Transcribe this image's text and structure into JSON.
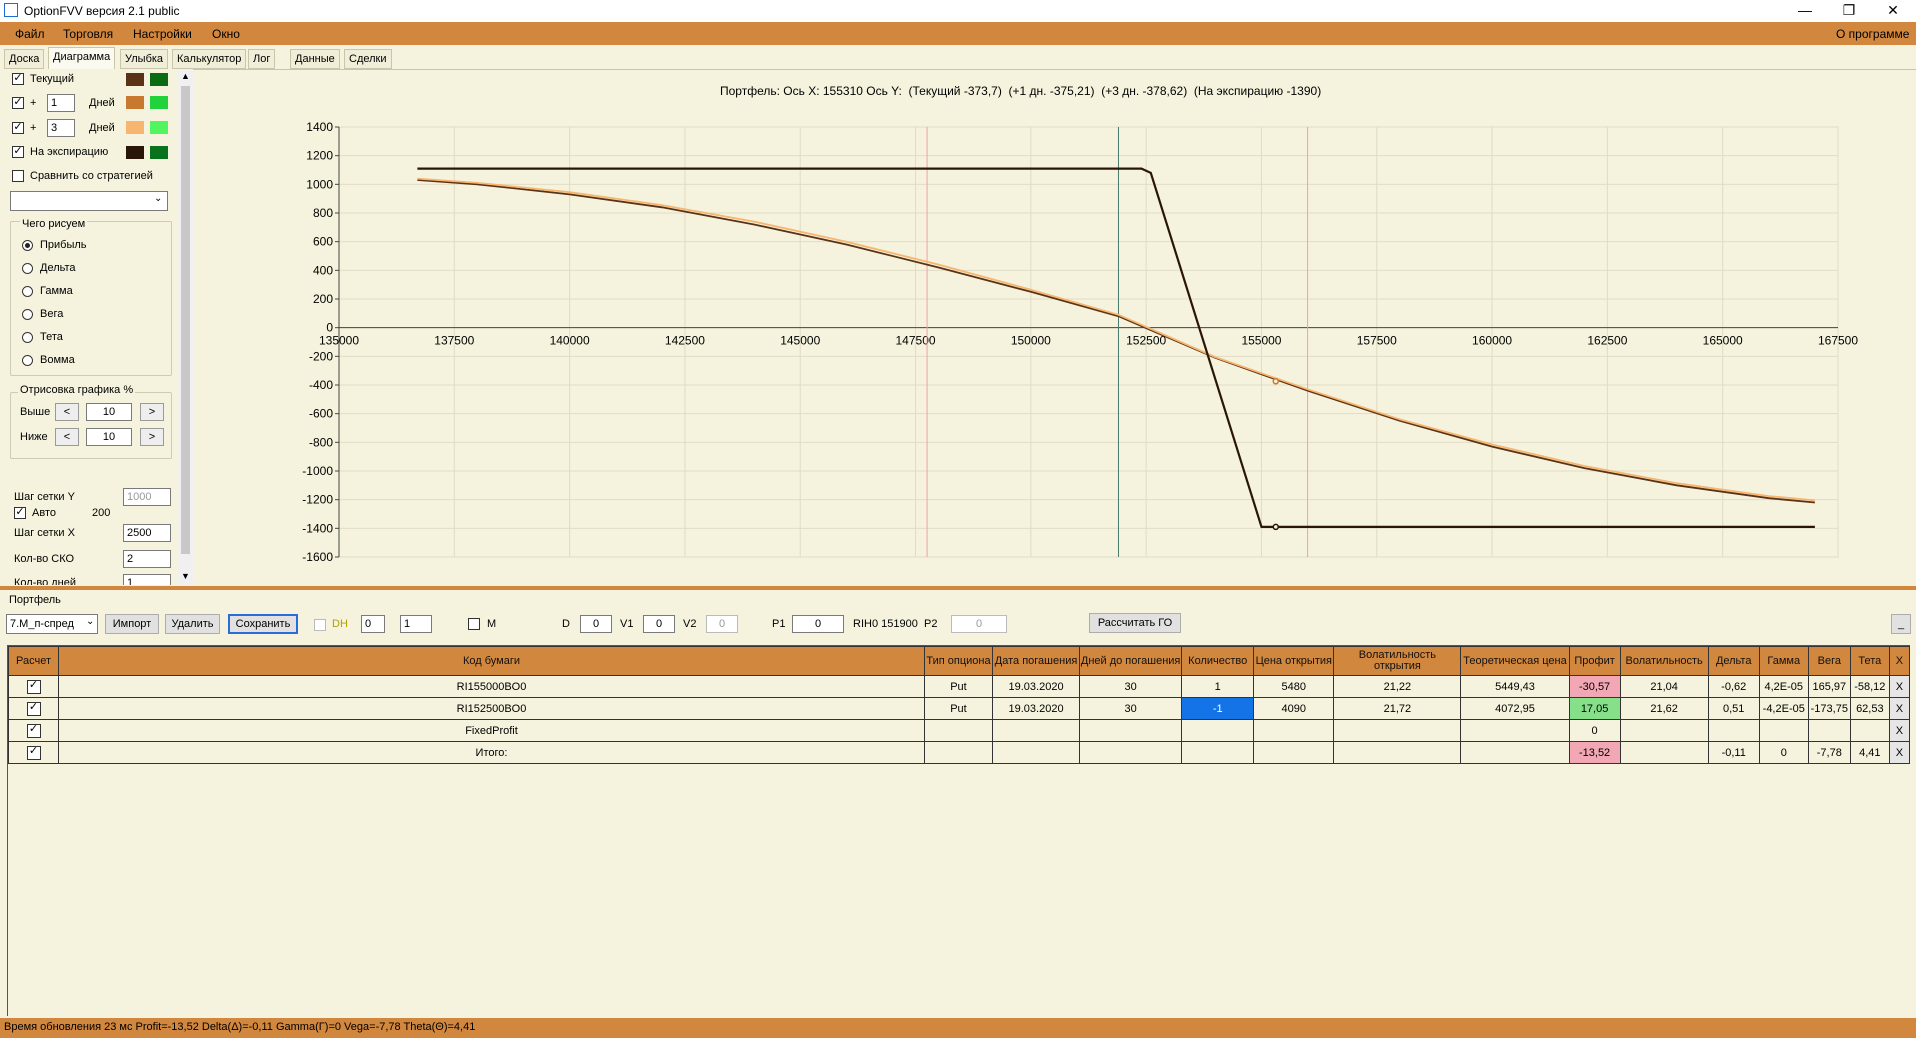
{
  "window": {
    "title": "OptionFVV версия 2.1 public",
    "minimize": "—",
    "restore": "❐",
    "close": "✕"
  },
  "menu": {
    "items": [
      "Файл",
      "Торговля",
      "Настройки",
      "Окно"
    ],
    "about": "О программе"
  },
  "tabs": [
    "Доска",
    "Диаграмма",
    "Улыбка",
    "Калькулятор",
    "Лог",
    "Данные",
    "Сделки"
  ],
  "active_tab": "Диаграмма",
  "left_panel": {
    "current_label": "Текущий",
    "plus": "+",
    "days1_value": "1",
    "days2_value": "3",
    "days_label": "Дней",
    "expiry_label": "На экспирацию",
    "compare_label": "Сравнить со стратегией",
    "draw_group_title": "Чего рисуем",
    "draw_options": [
      "Прибыль",
      "Дельта",
      "Гамма",
      "Вега",
      "Тета",
      "Вомма"
    ],
    "render_group_title": "Отрисовка графика %",
    "above_label": "Выше",
    "above_value": "10",
    "below_label": "Ниже",
    "below_value": "10",
    "dec": "<",
    "inc": ">",
    "grid_y_label": "Шаг сетки Y",
    "grid_y_value": "1000",
    "auto_label": "Авто",
    "auto_value": "200",
    "grid_x_label": "Шаг сетки X",
    "grid_x_value": "2500",
    "sko_label": "Кол-во СКО",
    "sko_value": "2",
    "days_count_label": "Кол-во дней",
    "days_count_value": "1",
    "colors": {
      "current": [
        "#5a3216",
        "#0a6b12"
      ],
      "plus1": [
        "#c8782f",
        "#21d23a"
      ],
      "plus3": [
        "#f7b56f",
        "#52f560"
      ],
      "expiry": [
        "#2a1608",
        "#08731a"
      ]
    }
  },
  "chart_header": "Портфель: Ось X: 155310 Ось Y:  (Текущий -373,7)  (+1 дн. -375,21)  (+3 дн. -378,62)  (На экспирацию -1390)",
  "chart_data": {
    "type": "line",
    "xlim": [
      135000,
      167500
    ],
    "ylim": [
      -1600,
      1400
    ],
    "x_ticks": [
      "135000",
      "137500",
      "140000",
      "142500",
      "145000",
      "147500",
      "150000",
      "152500",
      "155000",
      "157500",
      "160000",
      "162500",
      "165000",
      "167500"
    ],
    "y_ticks": [
      "1400",
      "1200",
      "1000",
      "800",
      "600",
      "400",
      "200",
      "0",
      "-200",
      "-400",
      "-600",
      "-800",
      "-1000",
      "-1200",
      "-1400",
      "-1600"
    ],
    "vertical_lines": [
      {
        "x": 147750,
        "color": "#f4a0a0"
      },
      {
        "x": 151900,
        "color": "#4a7a6a"
      },
      {
        "x": 156000,
        "color": "#f4a0a0"
      }
    ],
    "series": [
      {
        "color": "#5a3216",
        "x": [
          136700,
          138000,
          140000,
          142000,
          144000,
          146000,
          148000,
          150000,
          151900,
          154000,
          156000,
          158000,
          160000,
          162000,
          164000,
          166000,
          167000
        ],
        "y": [
          1030,
          1000,
          930,
          840,
          720,
          580,
          420,
          250,
          80,
          -210,
          -440,
          -650,
          -830,
          -980,
          -1100,
          -1190,
          -1220
        ]
      },
      {
        "color": "#f7b56f",
        "x": [
          136700,
          138000,
          140000,
          142000,
          144000,
          146000,
          148000,
          150000,
          151900,
          154000,
          156000,
          158000,
          160000,
          162000,
          164000,
          166000,
          167000
        ],
        "y": [
          1040,
          1010,
          945,
          855,
          740,
          600,
          440,
          265,
          90,
          -205,
          -430,
          -640,
          -815,
          -965,
          -1085,
          -1175,
          -1205
        ]
      },
      {
        "color": "#2a1608",
        "x": [
          136700,
          152400,
          152600,
          155000,
          167000
        ],
        "y": [
          1110,
          1110,
          1080,
          -1390,
          -1390
        ]
      }
    ],
    "markers": [
      {
        "x": 155310,
        "y": -374,
        "color": "#c8782f"
      },
      {
        "x": 155310,
        "y": -1390,
        "color": "#2a1608"
      }
    ],
    "grid": true
  },
  "portfolio": {
    "label": "Портфель",
    "selected": "7.М_п-спред",
    "import": "Импорт",
    "delete": "Удалить",
    "save": "Сохранить",
    "dh_label": "DH",
    "dh_val1": "0",
    "dh_val2": "1",
    "m_label": "M",
    "d_label": "D",
    "d_value": "0",
    "v1_label": "V1",
    "v1_value": "0",
    "v2_label": "V2",
    "v2_value": "0",
    "p1_label": "P1",
    "p1_value": "0",
    "rih_label": "RIH0 151900",
    "p2_label": "P2",
    "p2_value": "0",
    "calc_go": "Рассчитать ГО",
    "minimize": "_"
  },
  "table": {
    "headers": [
      "Расчет",
      "Код бумаги",
      "Тип опциона",
      "Дата погашения",
      "Дней до погашения",
      "Количество",
      "Цена открытия",
      "Волатильность открытия",
      "Теоретическая цена",
      "Профит",
      "Волатильность",
      "Дельта",
      "Гамма",
      "Вега",
      "Тета",
      "X"
    ],
    "rows": [
      {
        "check": "✓",
        "code": "RI155000BO0",
        "type": "Put",
        "date": "19.03.2020",
        "days": "30",
        "qty": "1",
        "open": "5480",
        "vol_open": "21,22",
        "theo": "5449,43",
        "profit": "-30,57",
        "vol": "21,04",
        "delta": "-0,62",
        "gamma": "4,2E-05",
        "vega": "165,97",
        "theta": "-58,12",
        "x": "X"
      },
      {
        "check": "✓",
        "code": "RI152500BO0",
        "type": "Put",
        "date": "19.03.2020",
        "days": "30",
        "qty": "-1",
        "open": "4090",
        "vol_open": "21,72",
        "theo": "4072,95",
        "profit": "17,05",
        "vol": "21,62",
        "delta": "0,51",
        "gamma": "-4,2E-05",
        "vega": "-173,75",
        "theta": "62,53",
        "x": "X"
      },
      {
        "check": "✓",
        "code": "FixedProfit",
        "type": "",
        "date": "",
        "days": "",
        "qty": "",
        "open": "",
        "vol_open": "",
        "theo": "",
        "profit": "0",
        "vol": "",
        "delta": "",
        "gamma": "",
        "vega": "",
        "theta": "",
        "x": "X"
      },
      {
        "check": "✓",
        "code": "Итого:",
        "type": "",
        "date": "",
        "days": "",
        "qty": "",
        "open": "",
        "vol_open": "",
        "theo": "",
        "profit": "-13,52",
        "vol": "",
        "delta": "-0,11",
        "gamma": "0",
        "vega": "-7,78",
        "theta": "4,41",
        "x": "X"
      }
    ]
  },
  "status": "Время обновления 23 мс  Profit=-13,52 Delta(Δ)=-0,11 Gamma(Γ)=0 Vega=-7,78 Theta(Θ)=4,41"
}
